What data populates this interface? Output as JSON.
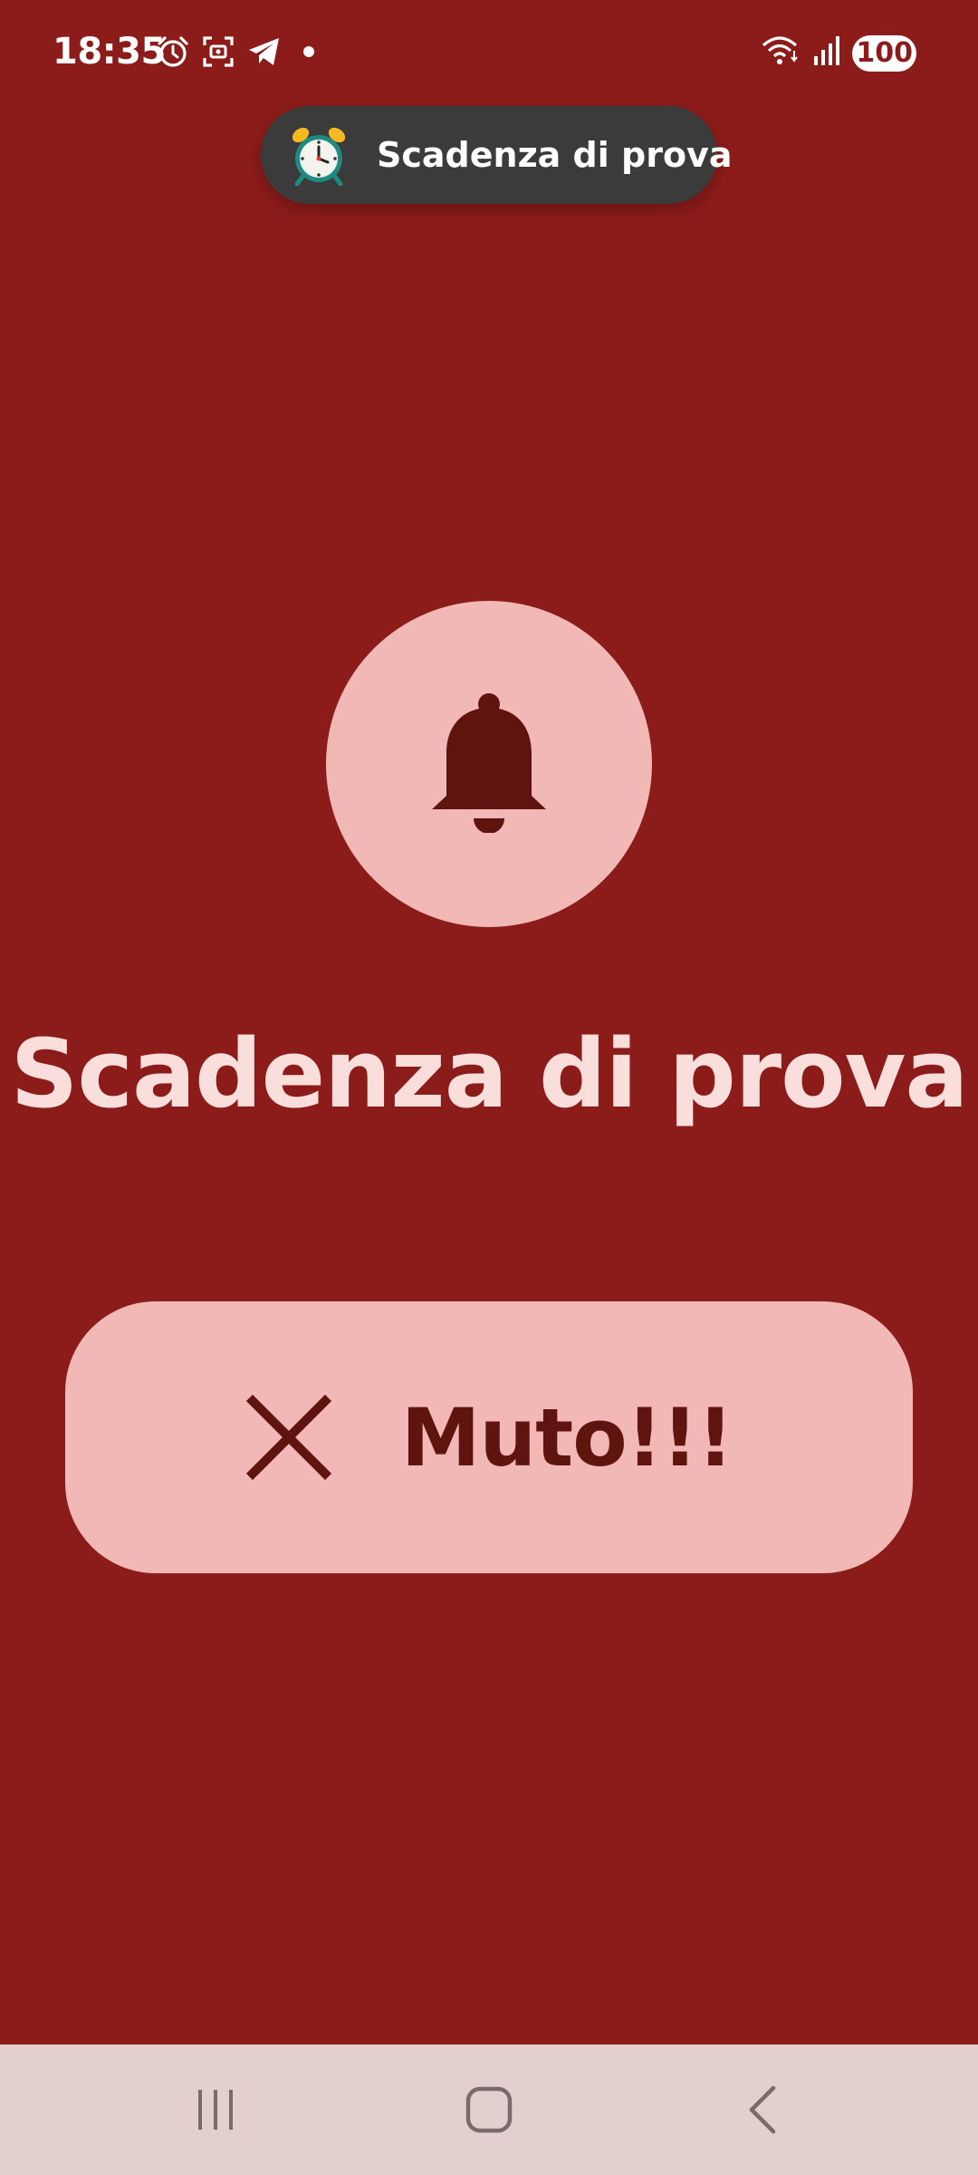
{
  "status_bar": {
    "time": "18:35",
    "battery_level": "100",
    "left_icons": [
      "alarm-icon",
      "screenshot-icon",
      "telegram-icon",
      "notification-dot-icon"
    ],
    "right_icons": [
      "wifi-icon",
      "signal-icon",
      "battery-icon"
    ]
  },
  "toast": {
    "icon": "alarm-clock-icon",
    "text": "Scadenza di prova"
  },
  "alarm": {
    "icon": "bell-icon",
    "title": "Scadenza di prova"
  },
  "mute_button": {
    "icon": "close-icon",
    "label": "Muto!!!"
  },
  "nav_bar": {
    "buttons": [
      "recent-apps-icon",
      "home-icon",
      "back-icon"
    ]
  },
  "colors": {
    "background": "#8c1c1a",
    "container": "#f2b8b5",
    "on_container": "#601410",
    "title_text": "#f9dedc",
    "toast_bg": "#3b3b3b",
    "nav_bar_bg": "#e4cfcf"
  }
}
